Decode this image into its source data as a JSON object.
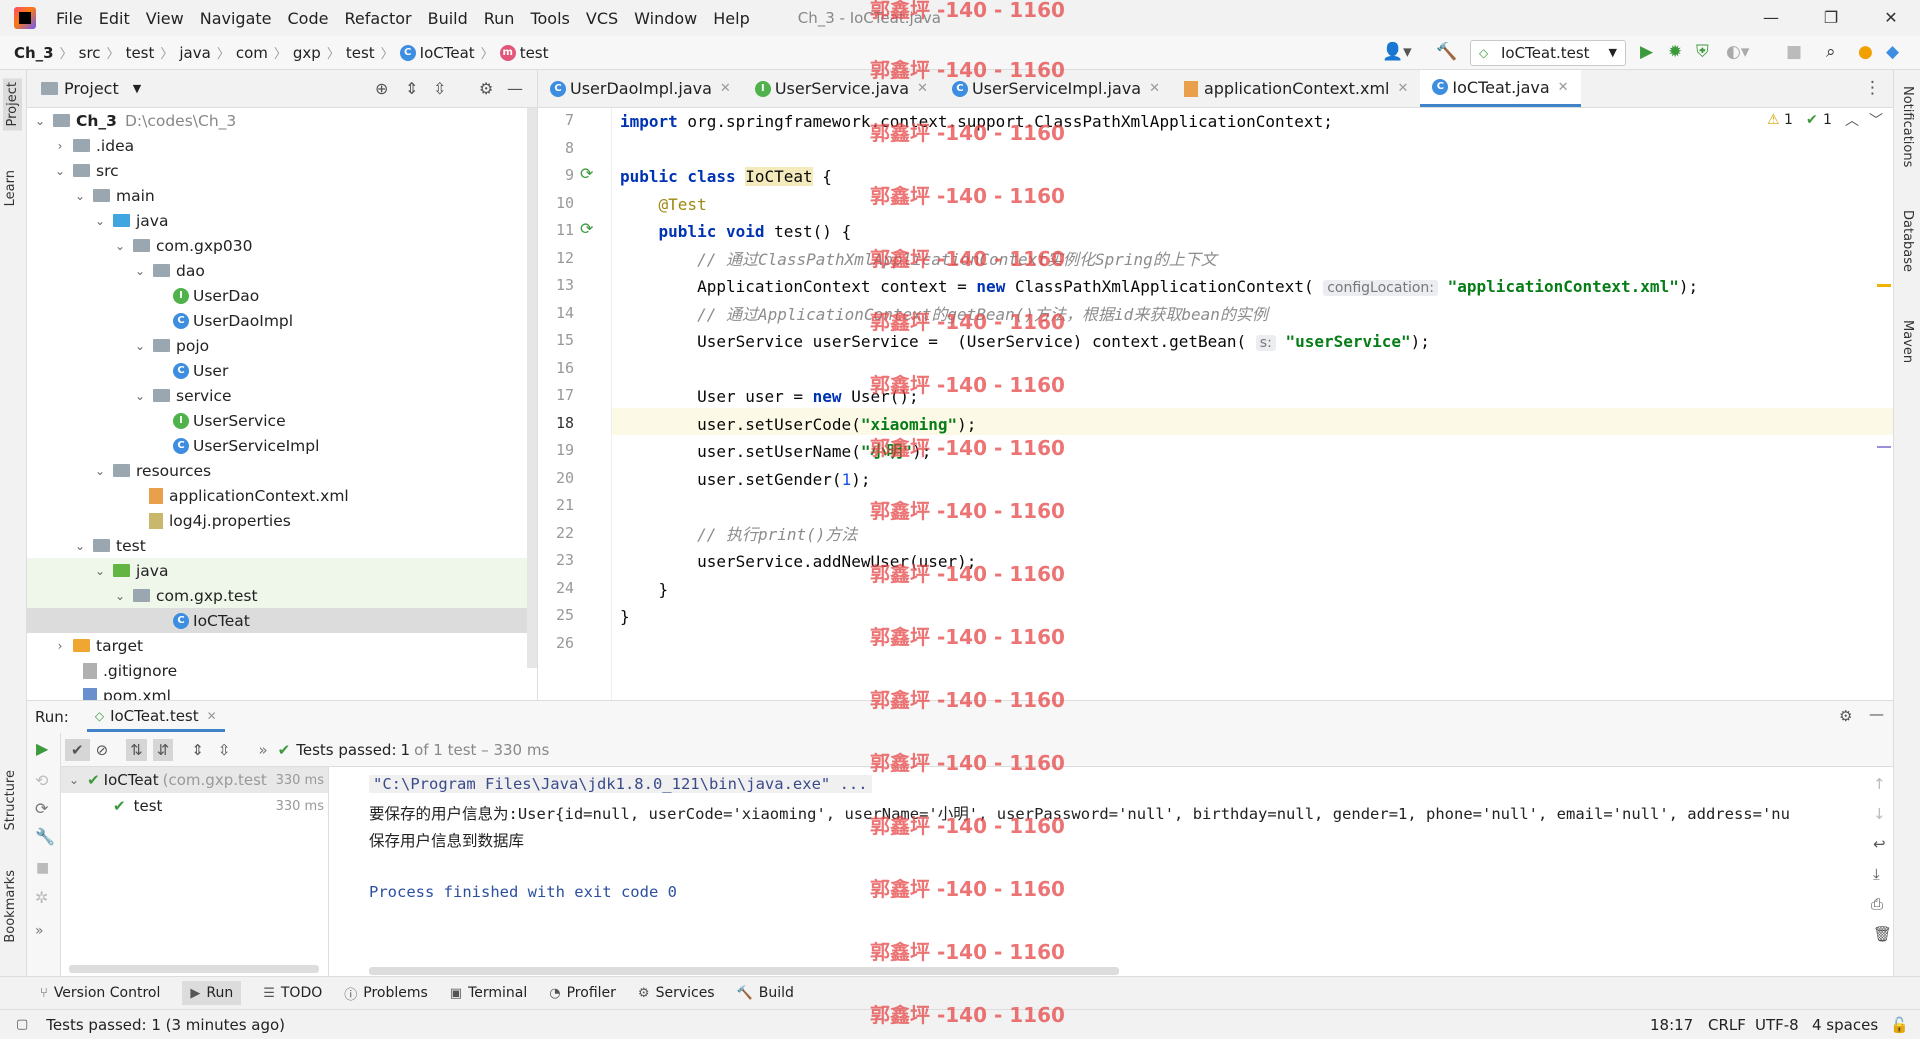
{
  "menu": [
    "File",
    "Edit",
    "View",
    "Navigate",
    "Code",
    "Refactor",
    "Build",
    "Run",
    "Tools",
    "VCS",
    "Window",
    "Help"
  ],
  "window_title": "Ch_3 - IoCTeat.java",
  "breadcrumb": [
    "Ch_3",
    "src",
    "test",
    "java",
    "com",
    "gxp",
    "test",
    "IoCTeat",
    "test"
  ],
  "run_config": "IoCTeat.test",
  "project_panel": {
    "title": "Project",
    "tree": [
      {
        "label": "Ch_3",
        "hint": "D:\\codes\\Ch_3"
      },
      {
        "label": ".idea"
      },
      {
        "label": "src"
      },
      {
        "label": "main"
      },
      {
        "label": "java"
      },
      {
        "label": "com.gxp030"
      },
      {
        "label": "dao"
      },
      {
        "label": "UserDao"
      },
      {
        "label": "UserDaoImpl"
      },
      {
        "label": "pojo"
      },
      {
        "label": "User"
      },
      {
        "label": "service"
      },
      {
        "label": "UserService"
      },
      {
        "label": "UserServiceImpl"
      },
      {
        "label": "resources"
      },
      {
        "label": "applicationContext.xml"
      },
      {
        "label": "log4j.properties"
      },
      {
        "label": "test"
      },
      {
        "label": "java"
      },
      {
        "label": "com.gxp.test"
      },
      {
        "label": "IoCTeat"
      },
      {
        "label": "target"
      },
      {
        "label": ".gitignore"
      },
      {
        "label": "pom.xml"
      }
    ]
  },
  "side_tabs_left": [
    "Project",
    "Learn",
    "Structure",
    "Bookmarks"
  ],
  "side_tabs_right": [
    "Notifications",
    "Database",
    "Maven"
  ],
  "editor_tabs": [
    "UserDaoImpl.java",
    "UserService.java",
    "UserServiceImpl.java",
    "applicationContext.xml",
    "IoCTeat.java"
  ],
  "editor": {
    "line_numbers": [
      "7",
      "8",
      "9",
      "10",
      "11",
      "12",
      "13",
      "14",
      "15",
      "16",
      "17",
      "18",
      "19",
      "20",
      "21",
      "22",
      "23",
      "24",
      "25",
      "26"
    ],
    "code": {
      "l7_kw": "import",
      "l7_rest": " org.springframework.context.support.ClassPathXmlApplicationContext;",
      "l9_kw": "public class",
      "l9_name": "IoCTeat",
      "l9_rest": " {",
      "l10": "@Test",
      "l11_kw": "public void",
      "l11_rest": " test() {",
      "l12": "// 通过ClassPathXmlApplicationContext实例化Spring的上下文",
      "l13_a": "ApplicationContext context = ",
      "l13_kw": "new",
      "l13_b": " ClassPathXmlApplicationContext(",
      "l13_hint": "configLocation:",
      "l13_str": "\"applicationContext.xml\"",
      "l13_end": ");",
      "l14": "// 通过ApplicationContext的getBean()方法，根据id来获取bean的实例",
      "l15_a": "UserService userService =  (UserService) context.getBean(",
      "l15_hint": "s:",
      "l15_str": "\"userService\"",
      "l15_end": ");",
      "l17_a": "User user = ",
      "l17_kw": "new",
      "l17_b": " User();",
      "l18_a": "user.setUserCode(",
      "l18_str": "\"xiaoming\"",
      "l18_end": ");",
      "l19_a": "user.setUserName(",
      "l19_str": "\"小明\"",
      "l19_end": ");",
      "l20_a": "user.setGender(",
      "l20_num": "1",
      "l20_end": ");",
      "l22": "// 执行print()方法",
      "l23": "userService.addNewUser(user);",
      "l24": "}",
      "l25": "}"
    },
    "inspections": {
      "warnings": "1",
      "ok": "1"
    }
  },
  "run_panel": {
    "label": "Run:",
    "tab": "IoCTeat.test",
    "tests_passed_label": "Tests passed:",
    "tests_passed_count": "1",
    "tests_passed_rest": "of 1 test – 330 ms",
    "tree": [
      {
        "name": "IoCTeat",
        "detail": "(com.gxp.test",
        "time": "330 ms"
      },
      {
        "name": "test",
        "time": "330 ms"
      }
    ],
    "console": [
      "\"C:\\Program Files\\Java\\jdk1.8.0_121\\bin\\java.exe\" ...",
      "要保存的用户信息为:User{id=null, userCode='xiaoming', userName='小明', userPassword='null', birthday=null, gender=1, phone='null', email='null', address='nu",
      "保存用户信息到数据库",
      "",
      "Process finished with exit code 0"
    ]
  },
  "bottom_tabs": [
    "Version Control",
    "Run",
    "TODO",
    "Problems",
    "Terminal",
    "Profiler",
    "Services",
    "Build"
  ],
  "status": {
    "message": "Tests passed: 1 (3 minutes ago)",
    "position": "18:17",
    "line_sep": "CRLF",
    "encoding": "UTF-8",
    "indent": "4 spaces"
  },
  "watermark": "郭鑫坪 -140 - 1160",
  "colors": {
    "keyword": "#0033b3",
    "string": "#067d17",
    "comment": "#8c8c8c",
    "accent": "#4083c9",
    "run_green": "#3c9a3c"
  }
}
